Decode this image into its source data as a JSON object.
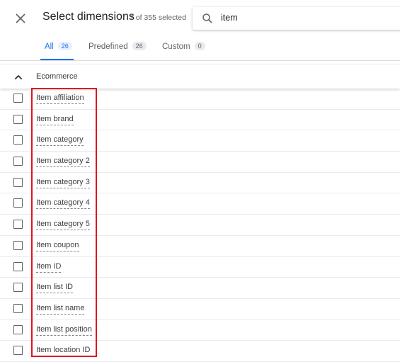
{
  "header": {
    "title": "Select dimensions",
    "selected_count": "2 of 355 selected",
    "close_icon": "close-icon"
  },
  "search": {
    "value": "item",
    "icon": "search-icon"
  },
  "tabs": [
    {
      "label": "All",
      "count": "26",
      "active": true
    },
    {
      "label": "Predefined",
      "count": "26",
      "active": false
    },
    {
      "label": "Custom",
      "count": "0",
      "active": false
    }
  ],
  "group": {
    "label": "Ecommerce",
    "icon": "chevron-up-icon"
  },
  "items": [
    {
      "label": "Item affiliation"
    },
    {
      "label": "Item brand"
    },
    {
      "label": "Item category"
    },
    {
      "label": "Item category 2"
    },
    {
      "label": "Item category 3"
    },
    {
      "label": "Item category 4"
    },
    {
      "label": "Item category 5"
    },
    {
      "label": "Item coupon"
    },
    {
      "label": "Item ID"
    },
    {
      "label": "Item list ID"
    },
    {
      "label": "Item list name"
    },
    {
      "label": "Item list position"
    },
    {
      "label": "Item location ID"
    }
  ],
  "colors": {
    "accent": "#1a73e8",
    "highlight": "#e0121f"
  }
}
